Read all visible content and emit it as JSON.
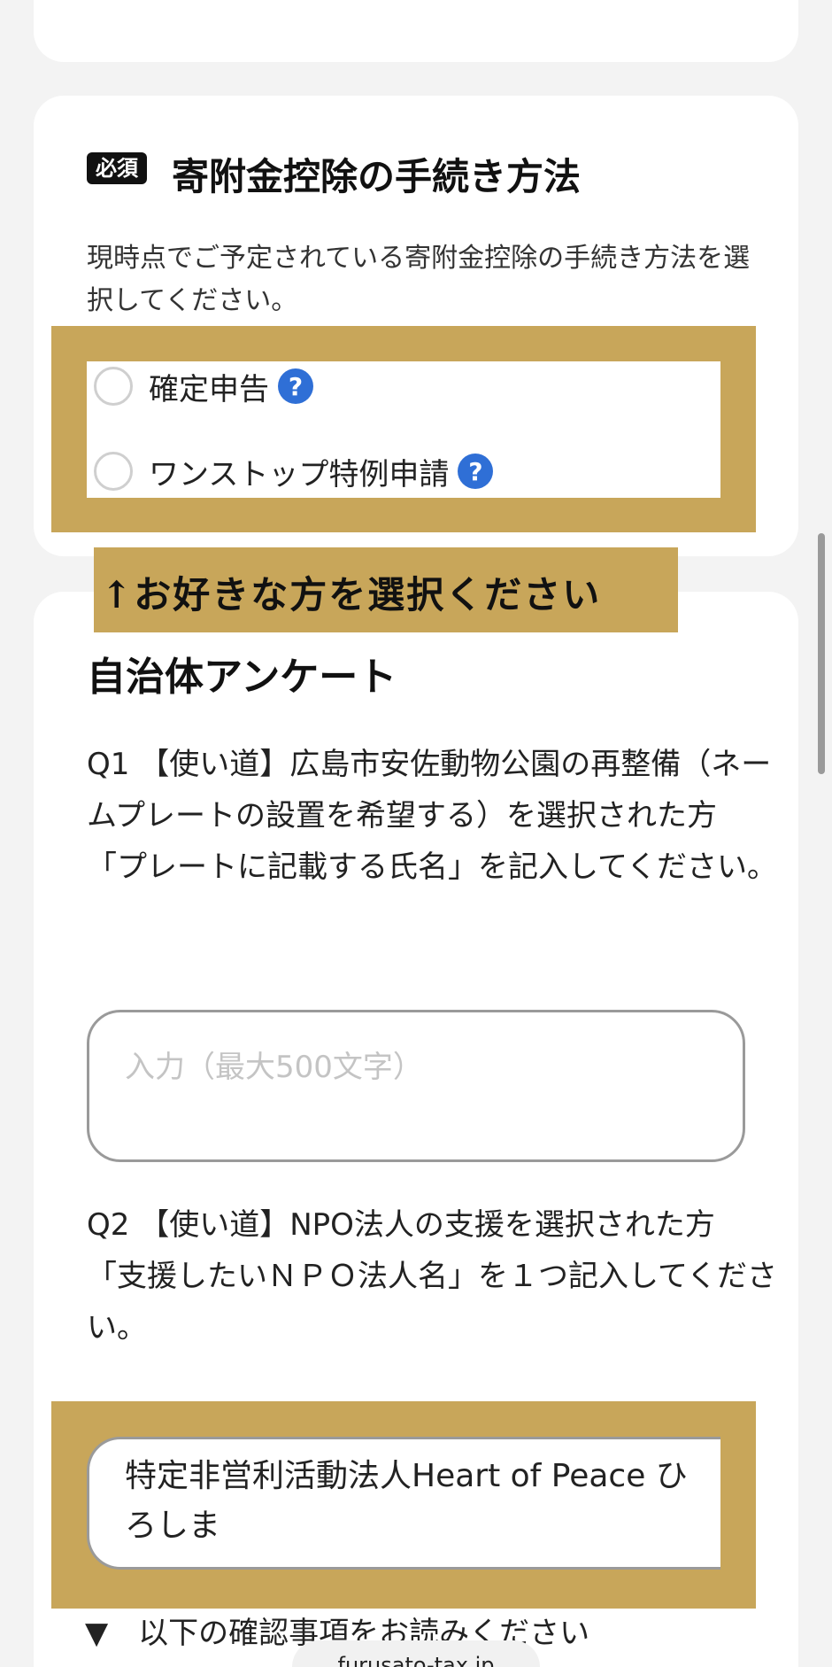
{
  "method_section": {
    "badge": "必須",
    "title": "寄附金控除の手続き方法",
    "description": "現時点でご予定されている寄附金控除の手続き方法を選択してください。",
    "options": [
      {
        "label": "確定申告",
        "help": "?"
      },
      {
        "label": "ワンストップ特例申請",
        "help": "?"
      }
    ]
  },
  "overlay_caption": "↑お好きな方を選択ください",
  "survey": {
    "title": "自治体アンケート",
    "q1": "Q1 【使い道】広島市安佐動物公園の再整備（ネームプレートの設置を希望する）を選択された方\n「プレートに記載する氏名」を記入してください。",
    "q1_placeholder": "入力（最大500文字）",
    "q2": "Q2 【使い道】NPO法人の支援を選択された方\n「支援したいＮＰＯ法人名」を１つ記入してください。",
    "q2_answer": "特定非営利活動法人Heart of Peace ひろしま"
  },
  "confirm_text": "▼　以下の確認事項をお読みください",
  "url": "furusato-tax.jp",
  "colors": {
    "gold_highlight": "#c8a65a",
    "help_icon": "#2f6fd6",
    "badge_bg": "#111111"
  }
}
